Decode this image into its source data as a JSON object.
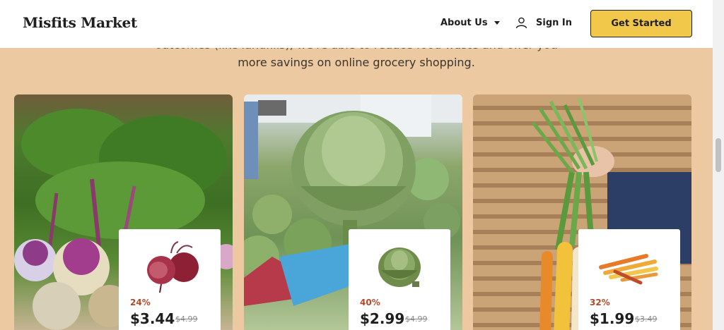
{
  "header": {
    "logo": "Misfits Market",
    "nav": {
      "about": "About Us",
      "signin": "Sign In"
    },
    "cta": "Get Started"
  },
  "intro": {
    "line1": "outcomes (like landfills), we're able to reduce food waste and offer you",
    "line2": "more savings on online grocery shopping."
  },
  "cards": [
    {
      "product": "beets-icon",
      "discount": "24%",
      "price": "$3.44",
      "original_price": "$4.99"
    },
    {
      "product": "artichoke-icon",
      "discount": "40%",
      "price": "$2.99",
      "original_price": "$4.99"
    },
    {
      "product": "carrots-icon",
      "discount": "32%",
      "price": "$1.99",
      "original_price": "$3.49"
    }
  ],
  "colors": {
    "page_bg": "#ecc9a0",
    "cta_bg": "#f2c84b",
    "discount": "#b24a2a"
  }
}
